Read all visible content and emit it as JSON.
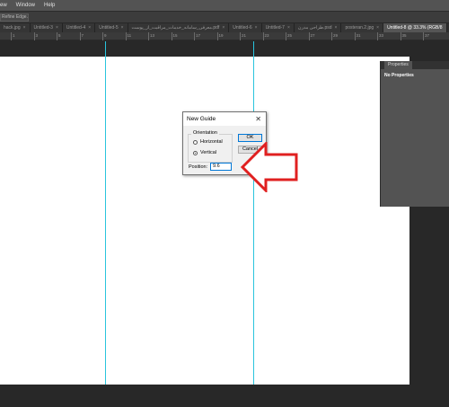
{
  "menubar": {
    "items": [
      "ew",
      "Window",
      "Help"
    ]
  },
  "options_bar": {
    "refine_edge": "Refine Edge..."
  },
  "tabs": [
    {
      "label": "hack.jpg",
      "close": "×"
    },
    {
      "label": "Untitled-3",
      "close": "×"
    },
    {
      "label": "Untitled-4",
      "close": "×"
    },
    {
      "label": "Untitled-5",
      "close": "×"
    },
    {
      "label": "معرفی_سامانه_خدمات_مراقبت_از_پوست.pdf",
      "close": "×"
    },
    {
      "label": "Untitled-6",
      "close": "×"
    },
    {
      "label": "Untitled-7",
      "close": "×"
    },
    {
      "label": "طراحی مدرن.psd",
      "close": "×"
    },
    {
      "label": "posteran.2.jpg",
      "close": "×"
    },
    {
      "label": "Untitled-8 @ 33.3% (RGB/8",
      "close": "×"
    }
  ],
  "ruler": {
    "numbers": [
      "1",
      "3",
      "5",
      "7",
      "9",
      "11",
      "13",
      "15",
      "17",
      "19",
      "21",
      "23",
      "25",
      "27",
      "29",
      "31",
      "33",
      "35",
      "37"
    ]
  },
  "properties": {
    "tab": "Properties",
    "body": "No Properties"
  },
  "dialog": {
    "title": "New Guide",
    "close": "✕",
    "orientation_label": "Orientation",
    "horizontal": "Horizontal",
    "vertical": "Vertical",
    "selected": "Vertical",
    "ok": "OK",
    "cancel": "Cancel",
    "position_label": "Position:",
    "position_value": "9.6"
  },
  "colors": {
    "guide": "#29c4dd",
    "arrow": "#e02020",
    "active_tab": "#555555"
  }
}
